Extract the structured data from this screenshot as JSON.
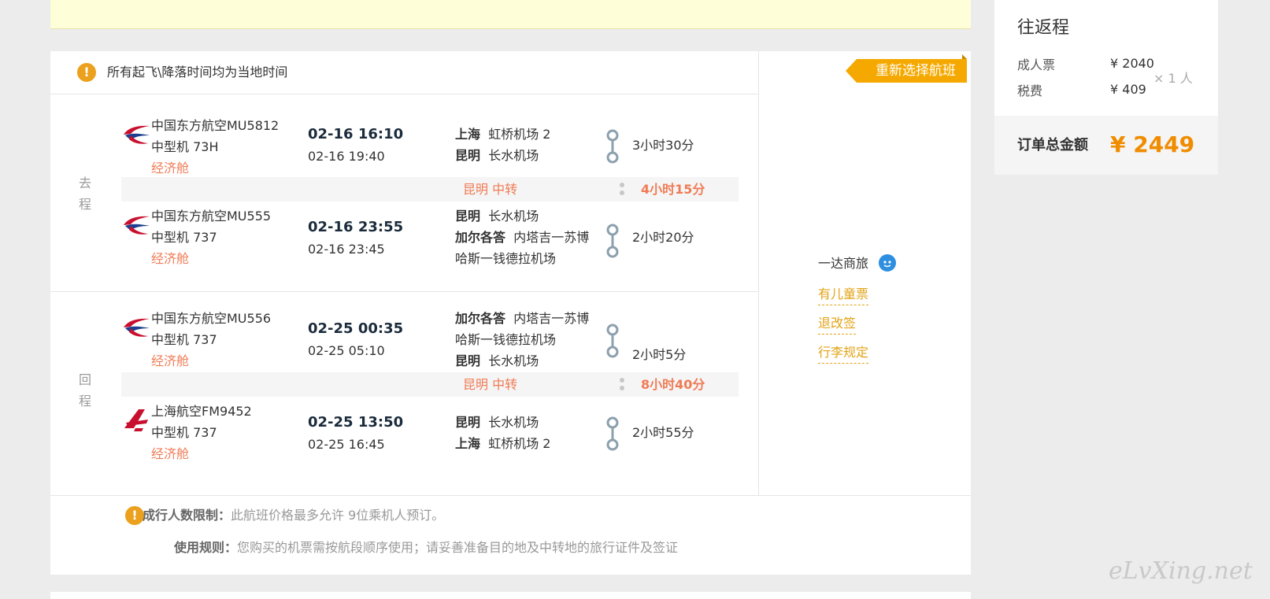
{
  "notice": {
    "icon": "exclamation-icon",
    "text": "所有起飞\\降落时间均为当地时间"
  },
  "colors": {
    "accent_orange": "#f5a900",
    "cabin_red": "#f07b55",
    "link_gold": "#e2a316",
    "total_orange": "#f08c00",
    "warn_icon": "#eba11e"
  },
  "outbound": {
    "label": "去程",
    "segments": [
      {
        "airline": "中国东方航空MU5812",
        "aircraft": "中型机 73H",
        "cabin": "经济舱",
        "dep_time": "02-16 16:10",
        "arr_time": "02-16 19:40",
        "dep_city": "上海",
        "dep_airport": "虹桥机场 2",
        "arr_city": "昆明",
        "arr_airport": "长水机场",
        "duration": "3小时30分"
      },
      {
        "airline": "中国东方航空MU555",
        "aircraft": "中型机 737",
        "cabin": "经济舱",
        "dep_time": "02-16 23:55",
        "arr_time": "02-16 23:45",
        "dep_city": "昆明",
        "dep_airport": "长水机场",
        "arr_city": "加尔各答",
        "arr_airport": "内塔吉一苏博",
        "arr_airport_line2": "哈斯一钱德拉机场",
        "duration": "2小时20分"
      }
    ],
    "transfer": {
      "city": "昆明 中转",
      "duration": "4小时15分"
    }
  },
  "return": {
    "label": "回程",
    "segments": [
      {
        "airline": "中国东方航空MU556",
        "aircraft": "中型机 737",
        "cabin": "经济舱",
        "dep_time": "02-25 00:35",
        "arr_time": "02-25 05:10",
        "dep_city": "加尔各答",
        "dep_airport": "内塔吉一苏博",
        "dep_airport_line2": "哈斯一钱德拉机场",
        "arr_city": "昆明",
        "arr_airport": "长水机场",
        "duration": "2小时5分"
      },
      {
        "airline": "上海航空FM9452",
        "aircraft": "中型机 737",
        "cabin": "经济舱",
        "dep_time": "02-25 13:50",
        "arr_time": "02-25 16:45",
        "dep_city": "昆明",
        "dep_airport": "长水机场",
        "arr_city": "上海",
        "arr_airport": "虹桥机场 2",
        "duration": "2小时55分"
      }
    ],
    "transfer": {
      "city": "昆明 中转",
      "duration": "8小时40分"
    }
  },
  "actions": {
    "reselect": "重新选择航班",
    "provider": "一达商旅",
    "links": [
      "有儿童票",
      "退改签",
      "行李规定"
    ]
  },
  "footer": {
    "limit_label": "成行人数限制：",
    "limit_text": "此航班价格最多允许 9位乘机人预订。",
    "rule_label": "使用规则：",
    "rule_text": "您购买的机票需按航段顺序使用；请妥善准备目的地及中转地的旅行证件及签证"
  },
  "summary": {
    "title": "往返程",
    "adult_label": "成人票",
    "adult_price": "¥ 2040",
    "tax_label": "税费",
    "tax_price": "¥ 409",
    "multiplier": "× 1 人",
    "total_label": "订单总金额",
    "total_value": "¥ 2449"
  },
  "watermark": "eLvXing.net"
}
